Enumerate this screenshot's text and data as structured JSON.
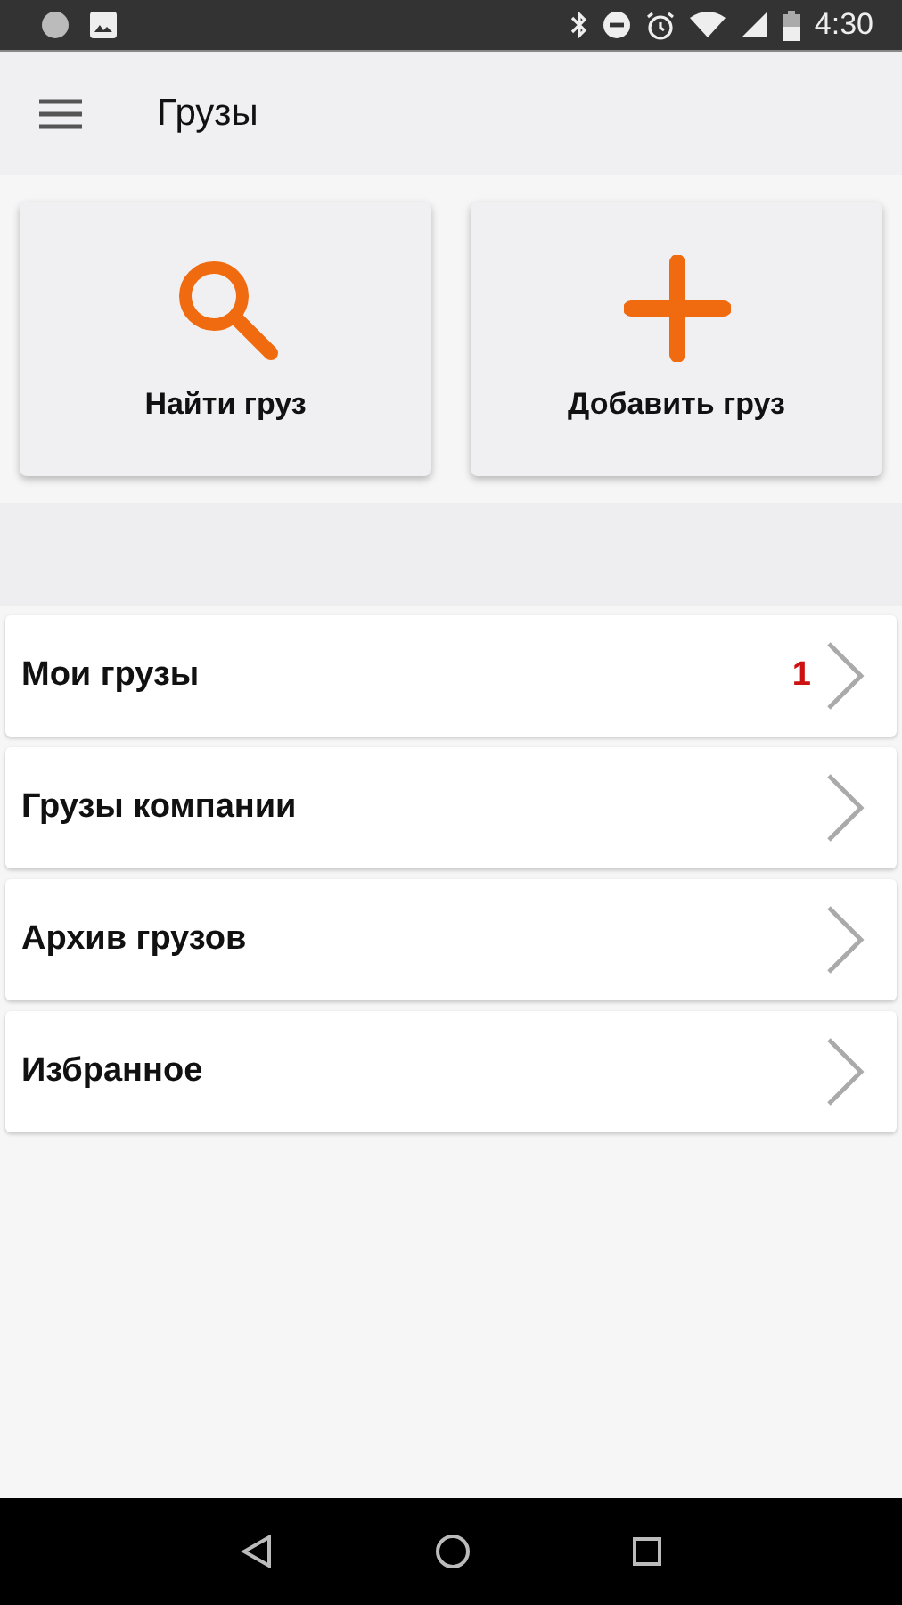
{
  "status_bar": {
    "time": "4:30"
  },
  "app_bar": {
    "title": "Грузы"
  },
  "actions": [
    {
      "kind": "search",
      "label": "Найти груз"
    },
    {
      "kind": "add",
      "label": "Добавить груз"
    }
  ],
  "menu": [
    {
      "label": "Мои грузы",
      "badge": "1"
    },
    {
      "label": "Грузы компании"
    },
    {
      "label": "Архив грузов"
    },
    {
      "label": "Избранное"
    }
  ]
}
